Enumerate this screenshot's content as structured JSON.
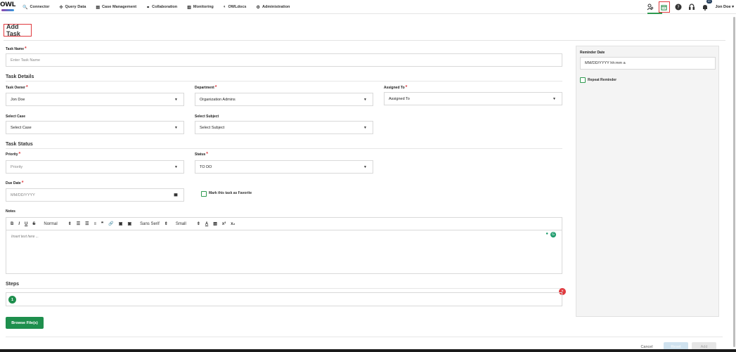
{
  "header": {
    "logo": "OWL",
    "nav": [
      {
        "label": "Connector",
        "icon": "search-icon",
        "glyph": "🔍"
      },
      {
        "label": "Query Data",
        "icon": "query-icon",
        "glyph": "✣"
      },
      {
        "label": "Case Management",
        "icon": "case-icon",
        "glyph": "▤"
      },
      {
        "label": "Collaboration",
        "icon": "collaboration-icon",
        "glyph": "⚭"
      },
      {
        "label": "Monitoring",
        "icon": "monitoring-icon",
        "glyph": "▥"
      },
      {
        "label": "OWLdocs",
        "icon": "docs-icon",
        "glyph": "◐"
      },
      {
        "label": "Administration",
        "icon": "admin-icon",
        "glyph": "⚙"
      }
    ],
    "notification_count": "10",
    "user_name": "Jon Doe",
    "user_caret": "▾"
  },
  "page": {
    "title": "Add Task"
  },
  "form": {
    "task_name": {
      "label": "Task Name",
      "placeholder": "Enter Task Name"
    },
    "task_details_heading": "Task Details",
    "task_owner": {
      "label": "Task Owner",
      "value": "Jon Doe"
    },
    "department": {
      "label": "Department",
      "value": "Organization Admins"
    },
    "assigned_to": {
      "label": "Assigned To",
      "value": "Assigned To"
    },
    "select_case": {
      "label": "Select Case",
      "value": "Select Case"
    },
    "select_subject": {
      "label": "Select Subject",
      "value": "Select Subject"
    },
    "task_status_heading": "Task Status",
    "priority": {
      "label": "Priority",
      "value": "Priority"
    },
    "status": {
      "label": "Status",
      "value": "TO DO"
    },
    "due_date": {
      "label": "Due Date",
      "placeholder": "MM/DD/YYYY"
    },
    "favorite": {
      "label": "Mark this task as Favorite",
      "checked": false
    },
    "notes": {
      "label": "Notes",
      "placeholder": "Insert text here ...",
      "toolbar": {
        "bold": "B",
        "italic": "I",
        "underline": "U",
        "strike": "S",
        "heading": "Normal",
        "ordered_list": "☰",
        "bullet_list": "☰",
        "align": "≡",
        "quote": "❞",
        "link": "🔗",
        "image": "▣",
        "video": "▣",
        "font": "Sans Serif",
        "size": "Small",
        "color": "A",
        "clean": "▧",
        "superscript": "x²",
        "subscript": "x₂",
        "updown": "⇕"
      }
    },
    "steps": {
      "heading": "Steps",
      "items": [
        "1"
      ],
      "remove": "×"
    },
    "browse_label": "Browse File(s)"
  },
  "reminder": {
    "label": "Reminder Date",
    "placeholder": "MM/DD/YYYY hh:mm a",
    "repeat_label": "Repeat Reminder"
  },
  "footer": {
    "cancel": "Cancel",
    "reset": "Reset",
    "add": "Add"
  },
  "colors": {
    "accent_green": "#1e8f4d",
    "required_red": "#e0393e"
  }
}
